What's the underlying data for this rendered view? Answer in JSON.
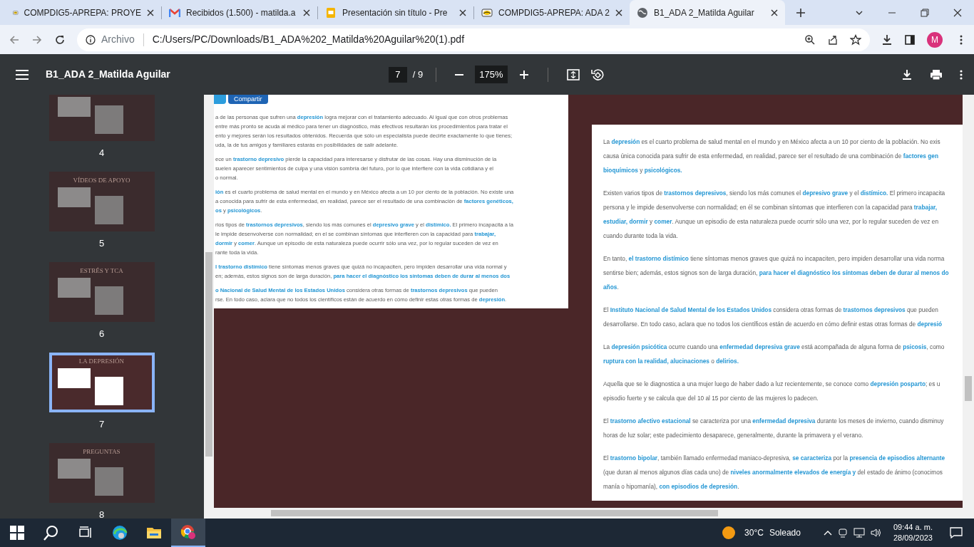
{
  "browser": {
    "tabs": [
      {
        "title": "COMPDIG5-APREPA: PROYE",
        "kind": "site",
        "selected": false
      },
      {
        "title": "Recibidos (1.500) - matilda.a",
        "kind": "mail",
        "selected": false
      },
      {
        "title": "Presentación sin título - Pre",
        "kind": "slides",
        "selected": false
      },
      {
        "title": "COMPDIG5-APREPA: ADA 2",
        "kind": "site",
        "selected": false
      },
      {
        "title": "B1_ADA 2_Matilda Aguilar",
        "kind": "globe",
        "selected": true
      }
    ],
    "omnibox": {
      "scheme": "Archivo",
      "url": "C:/Users/PC/Downloads/B1_ADA%202_Matilda%20Aguilar%20(1).pdf"
    },
    "profile_initial": "M"
  },
  "pdf_viewer": {
    "title": "B1_ADA 2_Matilda Aguilar",
    "page": "7",
    "page_total": "/ 9",
    "zoom": "175%",
    "thumbnails": [
      {
        "label": "4",
        "selected": false
      },
      {
        "label": "5",
        "title": "VÍDEOS DE APOYO",
        "selected": false
      },
      {
        "label": "6",
        "title": "ESTRÉS Y TCA",
        "selected": false
      },
      {
        "label": "7",
        "title": "LA DEPRESIÓN",
        "selected": true
      },
      {
        "label": "8",
        "title": "PREGUNTAS",
        "selected": false
      }
    ],
    "left_box": {
      "button": "Compartir",
      "paragraphs": [
        [
          "a de las personas que sufren una **depresión** logra mejorar con el tratamiento adecuado. Al igual que con otros problemas",
          "entre más pronto se acuda al médico para tener un diagnóstico, más efectivos resultarán los procedimientos para tratar el",
          "ento y mejores serán los resultados obtenidos. Recuerda que sólo un especialista puede decirte exactamente lo que tienes;",
          "uda, la de tus amigos y familiares estarás en posibilidades de salir adelante."
        ],
        [
          "ece un **trastorno depresivo** pierde la capacidad para interesarse y disfrutar de las cosas. Hay una disminución de la",
          "suelen aparecer sentimientos de culpa y una visión sombría del futuro, por lo que interfiere con la vida cotidiana y el",
          "o normal."
        ],
        [
          "**ión** es el cuarto problema de salud mental en el mundo y en México afecta a un 10 por ciento de la población. No existe una",
          "a conocida para sufrir de esta enfermedad, en realidad, parece ser el resultado de una combinación de **factores genéticos,**",
          "**os** y **psicológicos**."
        ],
        [
          "rios tipos de **trastornos depresivos**, siendo los más comunes el **depresivo grave** y el **distímico.** El primero incapacita a la",
          "le impide desenvolverse con normalidad; en el se combinan síntomas que interfieren con la capacidad para **trabajar,**",
          "**dormir** y **comer**. Aunque un episodio de esta naturaleza puede ocurrir sólo una vez, por lo regular suceden de vez en",
          "rante toda la vida."
        ],
        [
          "**l trastorno distímico** tiene síntomas menos graves que quizá no incapaciten, pero impiden desarrollar una vida normal y",
          "en; además, estos signos son de larga duración, **para hacer el diagnóstico los síntomas deben de durar al menos dos**"
        ],
        [
          "**o Nacional de Salud Mental de los Estados Unidos** considera otras formas de **trastornos depresivos** que pueden",
          "rse. En todo caso, aclara que no todos los científicos están de acuerdo en cómo definir estas otras formas de **depresión**."
        ]
      ]
    },
    "right_box": {
      "paragraphs": [
        [
          "La **depresión** es el cuarto problema de salud mental en el mundo y en México afecta a un 10 por ciento de la población. No exis",
          "causa única conocida para sufrir de esta enfermedad, en realidad, parece ser el resultado de una combinación de **factores gen**",
          "**bioquímicos** y **psicológicos.**"
        ],
        [
          "Existen varios tipos de **trastornos depresivos**, siendo los más comunes el **depresivo grave** y el **distímico.** El primero incapacita",
          "persona y le impide desenvolverse con normalidad; en él se combinan síntomas que interfieren con la capacidad para **trabajar,**",
          "**estudiar, dormir** y **comer**. Aunque un episodio de esta naturaleza puede ocurrir sólo una vez, por lo regular suceden de vez en",
          "cuando durante toda la vida."
        ],
        [
          "En tanto, **el trastorno distímico** tiene síntomas menos graves que quizá no incapaciten, pero impiden desarrollar una vida norma",
          "sentirse bien; además, estos signos son de larga duración, **para hacer el diagnóstico los síntomas deben de durar al menos do**",
          "**años**."
        ],
        [
          "El **Instituto Nacional de Salud Mental de los Estados Unidos** considera otras formas de **trastornos depresivos** que pueden",
          "desarrollarse. En todo caso, aclara que no todos los científicos están de acuerdo en cómo definir estas otras formas de **depresió**"
        ],
        [
          "La **depresión psicótica** ocurre cuando una **enfermedad depresiva grave** está acompañada de alguna forma de **psicosis**, como",
          "**ruptura con la realidad, alucinaciones** o **delirios.**"
        ],
        [
          "Aquella que se le diagnostica a una mujer luego de haber dado a luz recientemente, se conoce como **depresión posparto**; es u",
          "episodio fuerte y se calcula que del 10 al 15 por ciento de las mujeres lo padecen."
        ],
        [
          "El **trastorno afectivo estacional** se caracteriza por una **enfermedad depresiva** durante los meses de invierno, cuando disminuy",
          "horas de luz solar; este padecimiento desaparece, generalmente, durante la primavera y el verano."
        ],
        [
          "El **trastorno bipolar**, también llamado enfermedad maniaco-depresiva, **se caracteriza** por la **presencia de episodios alternante**",
          "(que duran al menos algunos días cada uno) de **niveles anormalmente elevados de energía y** del estado de ánimo (conocimos",
          "manía o hipomanía), **con episodios de depresión**."
        ]
      ]
    }
  },
  "taskbar": {
    "temperature": "30°C",
    "weather": "Soleado",
    "time": "09:44 a. m.",
    "date": "28/09/2023"
  }
}
